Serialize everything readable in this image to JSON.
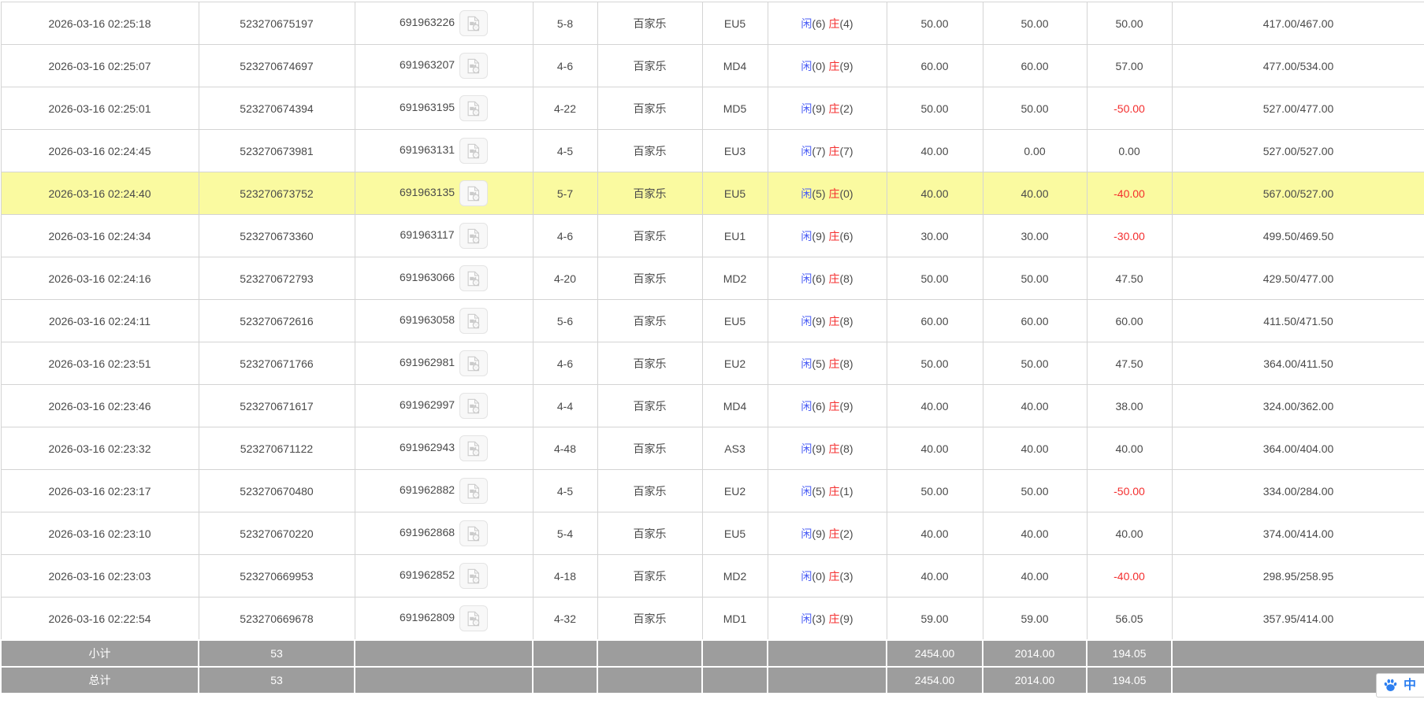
{
  "colors": {
    "highlight_yellow": "#fafaa0",
    "footer_gray": "#9d9d9d",
    "amount_blue": "#2b76f5",
    "player_blue": "#4a5df5",
    "banker_red": "#f42e2e",
    "border_gray": "#d4d4d4"
  },
  "table": {
    "result_labels": {
      "player": "闲",
      "banker": "庄"
    },
    "icons": {
      "video": "video-file-icon"
    },
    "rows": [
      {
        "time": "2026-03-16 02:25:18",
        "bet_id": "523270675197",
        "round_id": "691963226",
        "shoe_round": "5-8",
        "game": "百家乐",
        "table_code": "EU5",
        "result": {
          "player": 6,
          "banker": 4
        },
        "bet": "50.00",
        "valid": "50.00",
        "win_loss": "50.00",
        "balance": "417.00/467.00",
        "highlighted": false
      },
      {
        "time": "2026-03-16 02:25:07",
        "bet_id": "523270674697",
        "round_id": "691963207",
        "shoe_round": "4-6",
        "game": "百家乐",
        "table_code": "MD4",
        "result": {
          "player": 0,
          "banker": 9
        },
        "bet": "60.00",
        "valid": "60.00",
        "win_loss": "57.00",
        "balance": "477.00/534.00",
        "highlighted": false
      },
      {
        "time": "2026-03-16 02:25:01",
        "bet_id": "523270674394",
        "round_id": "691963195",
        "shoe_round": "4-22",
        "game": "百家乐",
        "table_code": "MD5",
        "result": {
          "player": 9,
          "banker": 2
        },
        "bet": "50.00",
        "valid": "50.00",
        "win_loss": "-50.00",
        "balance": "527.00/477.00",
        "highlighted": false
      },
      {
        "time": "2026-03-16 02:24:45",
        "bet_id": "523270673981",
        "round_id": "691963131",
        "shoe_round": "4-5",
        "game": "百家乐",
        "table_code": "EU3",
        "result": {
          "player": 7,
          "banker": 7
        },
        "bet": "40.00",
        "valid": "0.00",
        "win_loss": "0.00",
        "balance": "527.00/527.00",
        "highlighted": false
      },
      {
        "time": "2026-03-16 02:24:40",
        "bet_id": "523270673752",
        "round_id": "691963135",
        "shoe_round": "5-7",
        "game": "百家乐",
        "table_code": "EU5",
        "result": {
          "player": 5,
          "banker": 0
        },
        "bet": "40.00",
        "valid": "40.00",
        "win_loss": "-40.00",
        "balance": "567.00/527.00",
        "highlighted": true
      },
      {
        "time": "2026-03-16 02:24:34",
        "bet_id": "523270673360",
        "round_id": "691963117",
        "shoe_round": "4-6",
        "game": "百家乐",
        "table_code": "EU1",
        "result": {
          "player": 9,
          "banker": 6
        },
        "bet": "30.00",
        "valid": "30.00",
        "win_loss": "-30.00",
        "balance": "499.50/469.50",
        "highlighted": false
      },
      {
        "time": "2026-03-16 02:24:16",
        "bet_id": "523270672793",
        "round_id": "691963066",
        "shoe_round": "4-20",
        "game": "百家乐",
        "table_code": "MD2",
        "result": {
          "player": 6,
          "banker": 8
        },
        "bet": "50.00",
        "valid": "50.00",
        "win_loss": "47.50",
        "balance": "429.50/477.00",
        "highlighted": false
      },
      {
        "time": "2026-03-16 02:24:11",
        "bet_id": "523270672616",
        "round_id": "691963058",
        "shoe_round": "5-6",
        "game": "百家乐",
        "table_code": "EU5",
        "result": {
          "player": 9,
          "banker": 8
        },
        "bet": "60.00",
        "valid": "60.00",
        "win_loss": "60.00",
        "balance": "411.50/471.50",
        "highlighted": false
      },
      {
        "time": "2026-03-16 02:23:51",
        "bet_id": "523270671766",
        "round_id": "691962981",
        "shoe_round": "4-6",
        "game": "百家乐",
        "table_code": "EU2",
        "result": {
          "player": 5,
          "banker": 8
        },
        "bet": "50.00",
        "valid": "50.00",
        "win_loss": "47.50",
        "balance": "364.00/411.50",
        "highlighted": false
      },
      {
        "time": "2026-03-16 02:23:46",
        "bet_id": "523270671617",
        "round_id": "691962997",
        "shoe_round": "4-4",
        "game": "百家乐",
        "table_code": "MD4",
        "result": {
          "player": 6,
          "banker": 9
        },
        "bet": "40.00",
        "valid": "40.00",
        "win_loss": "38.00",
        "balance": "324.00/362.00",
        "highlighted": false
      },
      {
        "time": "2026-03-16 02:23:32",
        "bet_id": "523270671122",
        "round_id": "691962943",
        "shoe_round": "4-48",
        "game": "百家乐",
        "table_code": "AS3",
        "result": {
          "player": 9,
          "banker": 8
        },
        "bet": "40.00",
        "valid": "40.00",
        "win_loss": "40.00",
        "balance": "364.00/404.00",
        "highlighted": false
      },
      {
        "time": "2026-03-16 02:23:17",
        "bet_id": "523270670480",
        "round_id": "691962882",
        "shoe_round": "4-5",
        "game": "百家乐",
        "table_code": "EU2",
        "result": {
          "player": 5,
          "banker": 1
        },
        "bet": "50.00",
        "valid": "50.00",
        "win_loss": "-50.00",
        "balance": "334.00/284.00",
        "highlighted": false
      },
      {
        "time": "2026-03-16 02:23:10",
        "bet_id": "523270670220",
        "round_id": "691962868",
        "shoe_round": "5-4",
        "game": "百家乐",
        "table_code": "EU5",
        "result": {
          "player": 9,
          "banker": 2
        },
        "bet": "40.00",
        "valid": "40.00",
        "win_loss": "40.00",
        "balance": "374.00/414.00",
        "highlighted": false
      },
      {
        "time": "2026-03-16 02:23:03",
        "bet_id": "523270669953",
        "round_id": "691962852",
        "shoe_round": "4-18",
        "game": "百家乐",
        "table_code": "MD2",
        "result": {
          "player": 0,
          "banker": 3
        },
        "bet": "40.00",
        "valid": "40.00",
        "win_loss": "-40.00",
        "balance": "298.95/258.95",
        "highlighted": false
      },
      {
        "time": "2026-03-16 02:22:54",
        "bet_id": "523270669678",
        "round_id": "691962809",
        "shoe_round": "4-32",
        "game": "百家乐",
        "table_code": "MD1",
        "result": {
          "player": 3,
          "banker": 9
        },
        "bet": "59.00",
        "valid": "59.00",
        "win_loss": "56.05",
        "balance": "357.95/414.00",
        "highlighted": false
      }
    ],
    "footer": {
      "subtotal": {
        "label": "小计",
        "count": "53",
        "bet": "2454.00",
        "valid": "2014.00",
        "win_loss": "194.05"
      },
      "total": {
        "label": "总计",
        "count": "53",
        "bet": "2454.00",
        "valid": "2014.00",
        "win_loss": "194.05"
      }
    }
  },
  "overlay": {
    "translator": {
      "icon": "baidu-paw-icon",
      "label": "中"
    }
  }
}
